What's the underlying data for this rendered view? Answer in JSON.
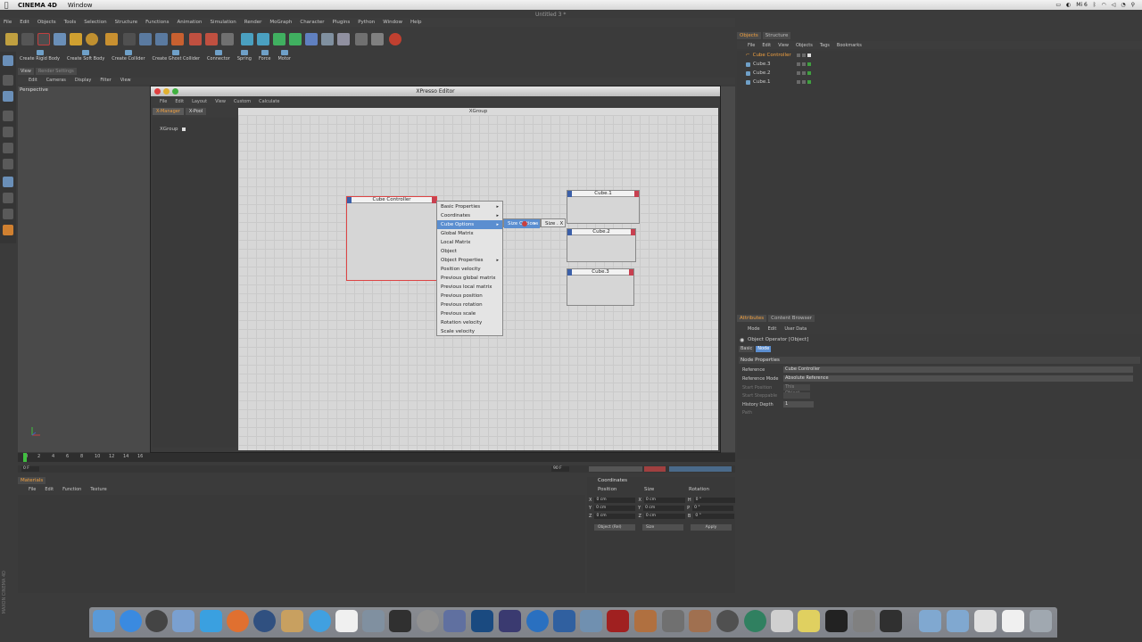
{
  "mac_menubar": {
    "app": "CINEMA 4D",
    "items": [
      "Window"
    ],
    "right_status": "Mi 6"
  },
  "document_title": "Untitled 3 *",
  "main_menu": [
    "File",
    "Edit",
    "Objects",
    "Tools",
    "Selection",
    "Structure",
    "Functions",
    "Animation",
    "Simulation",
    "Render",
    "MoGraph",
    "Character",
    "Plugins",
    "Python",
    "Window",
    "Help"
  ],
  "dynamics_toolbar": [
    "Create Rigid Body",
    "Create Soft Body",
    "Create Collider",
    "Create Ghost Collider",
    "Connector",
    "Spring",
    "Force",
    "Motor"
  ],
  "viewport": {
    "tabs": [
      "View",
      "Render Settings"
    ],
    "menu": [
      "Edit",
      "Cameras",
      "Display",
      "Filter",
      "View"
    ],
    "label": "Perspective"
  },
  "timeline": {
    "ticks": [
      "0",
      "2",
      "4",
      "6",
      "8",
      "10",
      "12",
      "14",
      "16"
    ],
    "start_frame": "0 F",
    "end_frame": "90 F"
  },
  "xpresso": {
    "title": "XPresso Editor",
    "menu": [
      "File",
      "Edit",
      "Layout",
      "View",
      "Custom",
      "Calculate"
    ],
    "tabs": [
      "X-Manager",
      "X-Pool"
    ],
    "tree_item": "XGroup",
    "group_header": "XGroup",
    "nodes": {
      "controller": "Cube Controller",
      "cube1": "Cube.1",
      "cube2": "Cube.2",
      "cube3": "Cube.3"
    },
    "context_menu": [
      {
        "label": "Basic Properties",
        "sub": true
      },
      {
        "label": "Coordinates",
        "sub": true
      },
      {
        "label": "Cube Options",
        "sub": true
      },
      {
        "label": "Global Matrix",
        "sub": false
      },
      {
        "label": "Local Matrix",
        "sub": false
      },
      {
        "label": "Object",
        "sub": false
      },
      {
        "label": "Object Properties",
        "sub": true
      },
      {
        "label": "Position velocity",
        "sub": false
      },
      {
        "label": "Previous global matrix",
        "sub": false
      },
      {
        "label": "Previous local matrix",
        "sub": false
      },
      {
        "label": "Previous position",
        "sub": false
      },
      {
        "label": "Previous rotation",
        "sub": false
      },
      {
        "label": "Previous scale",
        "sub": false
      },
      {
        "label": "Rotation velocity",
        "sub": false
      },
      {
        "label": "Scale velocity",
        "sub": false
      }
    ],
    "submenu1": "Size Options",
    "submenu2": "Size . X"
  },
  "objects_panel": {
    "tabs": [
      "Objects",
      "Structure"
    ],
    "menu": [
      "File",
      "Edit",
      "View",
      "Objects",
      "Tags",
      "Bookmarks"
    ],
    "items": [
      "Cube Controller",
      "Cube.3",
      "Cube.2",
      "Cube.1"
    ]
  },
  "attributes_panel": {
    "tabs": [
      "Attributes",
      "Content Browser"
    ],
    "menu": [
      "Mode",
      "Edit",
      "User Data"
    ],
    "title": "Object Operator [Object]",
    "subtabs": [
      "Basic",
      "Node"
    ],
    "section": "Node Properties",
    "rows": [
      {
        "label": "Reference",
        "value": "Cube Controller",
        "dim": false
      },
      {
        "label": "Reference Mode",
        "value": "Absolute Reference",
        "dim": false
      },
      {
        "label": "Start Position",
        "value": "This Object",
        "dim": true
      },
      {
        "label": "Start Steppable",
        "value": "",
        "dim": true
      },
      {
        "label": "History Depth",
        "value": "1",
        "dim": false
      },
      {
        "label": "Path",
        "value": "",
        "dim": true
      }
    ]
  },
  "materials_panel": {
    "tab": "Materials",
    "menu": [
      "File",
      "Edit",
      "Function",
      "Texture"
    ]
  },
  "coordinates_panel": {
    "title": "Coordinates",
    "headers": [
      "Position",
      "Size",
      "Rotation"
    ],
    "rows": [
      {
        "axis": "X",
        "pos": "0 cm",
        "size_axis": "X",
        "size": "0 cm",
        "rot_axis": "H",
        "rot": "0 °"
      },
      {
        "axis": "Y",
        "pos": "0 cm",
        "size_axis": "Y",
        "size": "0 cm",
        "rot_axis": "P",
        "rot": "0 °"
      },
      {
        "axis": "Z",
        "pos": "0 cm",
        "size_axis": "Z",
        "size": "0 cm",
        "rot_axis": "B",
        "rot": "0 °"
      }
    ],
    "mode_select": "Object (Rel)",
    "size_select": "Size",
    "apply": "Apply"
  },
  "side_logo": "MAXON CINEMA 4D",
  "colors": {
    "accent": "#f0a040",
    "highlight": "#5b8ed0",
    "node_in": "#3b5fa8",
    "node_out": "#c84050"
  }
}
